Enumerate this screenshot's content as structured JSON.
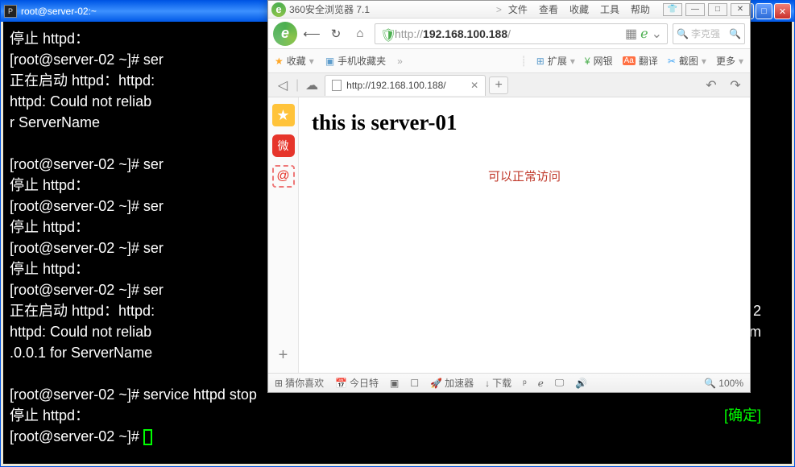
{
  "terminal": {
    "title": "root@server-02:~",
    "lines": {
      "l1": "停止 httpd：",
      "l2a": "[root@server-02 ~]# ",
      "l2b": "ser",
      "l3": "正在启动 httpd：httpd:",
      "l4": "httpd: Could not reliab",
      "l5": "r ServerName",
      "l6a": "[root@server-02 ~]# ",
      "l6b": "ser",
      "l7": "停止 httpd：",
      "l8a": "[root@server-02 ~]# ",
      "l8b": "ser",
      "l9": "停止 httpd：",
      "l10a": "[root@server-02 ~]# ",
      "l10b": "ser",
      "l11": "停止 httpd：",
      "l12a": "[root@server-02 ~]# ",
      "l12b": "ser",
      "l13": "正在启动 httpd：httpd:",
      "l14": "httpd: Could not reliab",
      "l15": ".0.0.1 for ServerName",
      "l16a": "[root@server-02 ~]# ",
      "l16b": "service httpd stop",
      "l17": "停止 httpd：",
      "l17r": "[确定]",
      "l18": "[root@server-02 ~]# ",
      "frag_r1": "2",
      "frag_r2": "lom"
    }
  },
  "browser": {
    "brand": "360安全浏览器 7.1",
    "brand_letter": "e",
    "menu": {
      "file": "文件",
      "view": "查看",
      "fav": "收藏",
      "tools": "工具",
      "help": "帮助"
    },
    "wincontrols": {
      "pin": "👕",
      "min": "—",
      "max": "□",
      "close": "✕"
    },
    "nav": {
      "back": "⟵",
      "fwd": "⟶",
      "reload": "↻",
      "home": "⌂",
      "shield": "🛡"
    },
    "url_prefix": "http://",
    "url_ip": "192.168.100.188",
    "url_suffix": "/",
    "addr_right": {
      "qr": "▦",
      "eicon": "ℯ",
      "drop": "⌄"
    },
    "search_icon": "🔍",
    "search_placeholder": "李克强",
    "bookmarks": {
      "fav": "收藏",
      "mobile": "手机收藏夹",
      "more": "»",
      "ext": "扩展",
      "bank": "网银",
      "trans": "翻译",
      "shot": "截图",
      "moreR": "更多",
      "ext_ico": "⊞",
      "bank_ico": "¥",
      "trans_ico": "Aa",
      "shot_ico": "✂"
    },
    "tabs": {
      "back": "◁",
      "cloud": "☁",
      "title": "http://192.168.100.188/",
      "close": "✕",
      "new": "+",
      "r1": "↶",
      "r2": "↷"
    },
    "side": {
      "star": "★",
      "weibo": "微",
      "at": "@",
      "plus": "+"
    },
    "page": {
      "heading": "this is server-01",
      "note": "可以正常访问"
    },
    "status": {
      "guess": "猜你喜欢",
      "today": "今日特",
      "accel": "加速器",
      "download": "下载",
      "zoom": "100%",
      "i_hot": "⊞",
      "i_cal": "📅",
      "i_a": "▣",
      "i_b": "☐",
      "i_rocket": "🚀",
      "i_dl": "↓",
      "i_c": "ᵖ",
      "i_d": "ℯ",
      "i_e": "🖵",
      "i_f": "🔊",
      "i_zoom": "🔍"
    }
  }
}
